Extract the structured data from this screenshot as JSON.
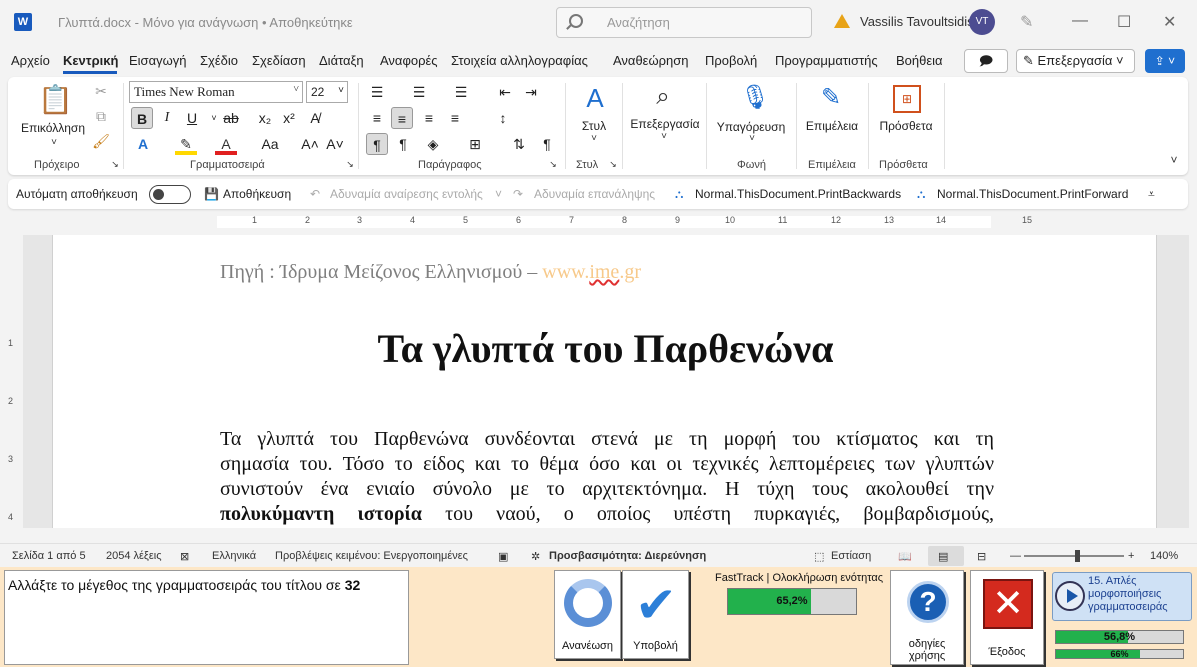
{
  "titlebar": {
    "app_icon": "W",
    "document_title": "Γλυπτά.docx  -  Μόνο για ανάγνωση  •  Αποθηκεύτηκε",
    "search_placeholder": "Αναζήτηση",
    "user_name": "Vassilis Tavoultsidis",
    "user_initials": "VT",
    "minimize": "—",
    "maximize": "☐",
    "close": "✕"
  },
  "tabs": [
    "Αρχείο",
    "Κεντρική",
    "Εισαγωγή",
    "Σχέδιο",
    "Σχεδίαση",
    "Διάταξη",
    "Αναφορές",
    "Στοιχεία αλληλογραφίας",
    "Αναθεώρηση",
    "Προβολή",
    "Προγραμματιστής",
    "Βοήθεια"
  ],
  "active_tab": "Κεντρική",
  "header_buttons": {
    "edit_mode": "Επεξεργασία ˅"
  },
  "ribbon": {
    "paste_label": "Επικόλληση",
    "font_name": "Times New Roman",
    "font_size": "22",
    "style_label": "Στυλ",
    "editing_label": "Επεξεργασία",
    "dictation_label": "Υπαγόρευση",
    "editor_label": "Επιμέλεια",
    "addins_label": "Πρόσθετα",
    "groups": {
      "clipboard": "Πρόχειρο",
      "font": "Γραμματοσειρά",
      "paragraph": "Παράγραφος",
      "styles": "Στυλ",
      "voice": "Φωνή",
      "editor": "Επιμέλεια",
      "addins": "Πρόσθετα"
    }
  },
  "quick_access": {
    "autosave": "Αυτόματη αποθήκευση",
    "save": "Αποθήκευση",
    "undo": "Αδυναμία αναίρεσης εντολής",
    "redo": "Αδυναμία επανάληψης",
    "macro1": "Normal.ThisDocument.PrintBackwards",
    "macro2": "Normal.ThisDocument.PrintForward"
  },
  "ruler": {
    "numbers": [
      "1",
      "2",
      "3",
      "4",
      "5",
      "6",
      "7",
      "8",
      "9",
      "10",
      "11",
      "12",
      "13",
      "14",
      "15"
    ],
    "vertical_numbers": [
      "1",
      "2",
      "3",
      "4"
    ]
  },
  "document": {
    "source_prefix": "Πηγή : Ίδρυμα Μείζονος Ελληνισμού – ",
    "source_link_a": "www.",
    "source_link_b": "ime",
    "source_link_c": ".gr",
    "title": "Τα γλυπτά του Παρθενώνα",
    "paragraph_lines": [
      "Τα γλυπτά του Παρθενώνα συνδέονται στενά με τη μορφή του κτίσματος και τη",
      "σημασία του. Τόσο το είδος και το θέμα όσο και οι τεχνικές λεπτομέρειες των γλυπτών",
      "συνιστούν ένα ενιαίο σύνολο με το αρχιτεκτόνημα. Η τύχη τους ακολουθεί την"
    ],
    "line4_bold": "πολυκύμαντη ιστορία",
    "line4_rest": " του ναού, ο οποίος υπέστη πυρκαγιές, βομβαρδισμούς,"
  },
  "statusbar": {
    "page": "Σελίδα 1 από 5",
    "words": "2054 λέξεις",
    "language": "Ελληνικά",
    "predictions": "Προβλέψεις κειμένου: Ενεργοποιημένες",
    "accessibility": "Προσβασιμότητα: Διερεύνηση",
    "focus": "Εστίαση",
    "zoom": "140%"
  },
  "task": {
    "instruction_text": "Αλλάξτε το μέγεθος της γραμματοσειράς του τίτλου σε ",
    "instruction_value": "32",
    "refresh_label": "Ανανέωση",
    "submit_label": "Υποβολή",
    "fasttrack_label": "FastTrack | Ολοκλήρωση ενότητας",
    "fasttrack_progress": "65,2%",
    "fasttrack_value": 0.652,
    "help_label_1": "οδηγίες",
    "help_label_2": "χρήσης",
    "exit_label": "Έξοδος",
    "lesson_title": "15. Απλές μορφοποιήσεις γραμματοσειράς",
    "lesson_progress_1": "56,8%",
    "lesson_value_1": 0.568,
    "lesson_progress_2": "66%",
    "lesson_value_2": 0.66
  },
  "colors": {
    "accent": "#185abd",
    "progress_fill": "#22b14c",
    "task_panel_bg": "#fde7c7",
    "link_color": "#f7c98a"
  }
}
